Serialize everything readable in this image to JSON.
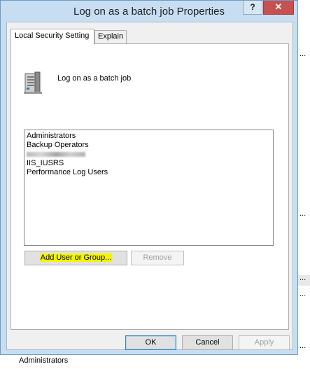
{
  "background": {
    "top_text": "Log on as a batch job",
    "bottom_text": "Administrators",
    "ellipsis": "..."
  },
  "window": {
    "title": "Log on as a batch job Properties",
    "help_label": "?",
    "close_label": "✕"
  },
  "tabs": [
    {
      "label": "Local Security Setting",
      "active": true
    },
    {
      "label": "Explain",
      "active": false
    }
  ],
  "policy": {
    "name": "Log on as a batch job",
    "icon": "server-icon"
  },
  "members": [
    "Administrators",
    "Backup Operators",
    "",
    "IIS_IUSRS",
    "Performance Log Users"
  ],
  "buttons": {
    "add": "Add User or Group...",
    "remove": "Remove",
    "ok": "OK",
    "cancel": "Cancel",
    "apply": "Apply"
  },
  "colors": {
    "highlight": "#f3f600",
    "close_red": "#c75050",
    "frame": "#c7def2"
  }
}
